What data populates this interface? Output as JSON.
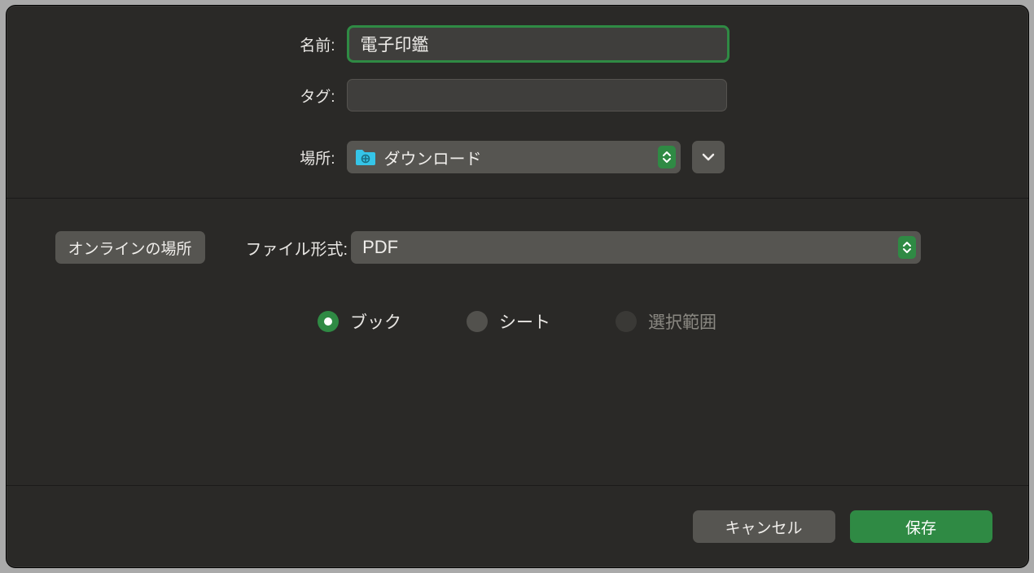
{
  "labels": {
    "name": "名前:",
    "tags": "タグ:",
    "location": "場所:",
    "fileFormat": "ファイル形式:",
    "onlineLocations": "オンラインの場所"
  },
  "fields": {
    "name": "電子印鑑",
    "tags": "",
    "location": "ダウンロード",
    "fileFormat": "PDF"
  },
  "radios": {
    "book": "ブック",
    "sheet": "シート",
    "selection": "選択範囲"
  },
  "buttons": {
    "cancel": "キャンセル",
    "save": "保存"
  },
  "colors": {
    "accent": "#2f8a44"
  }
}
